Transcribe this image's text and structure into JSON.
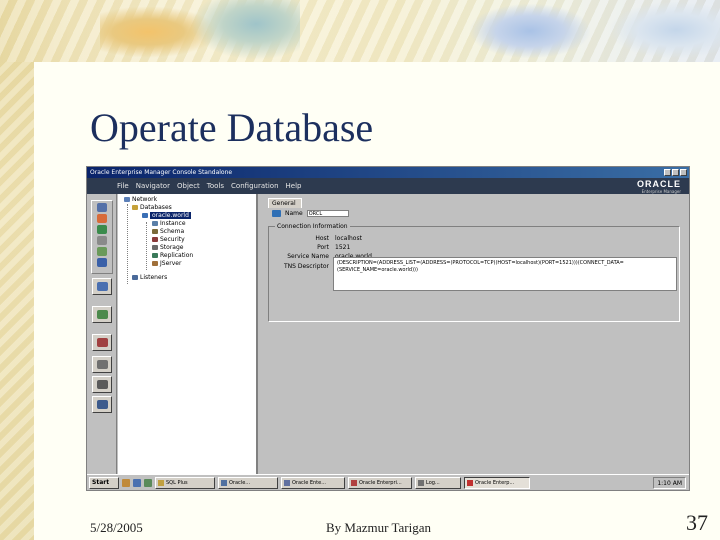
{
  "slide": {
    "title": "Operate Database",
    "footer_date": "5/28/2005",
    "footer_author": "By Mazmur Tarigan",
    "page_number": "37"
  },
  "window": {
    "title": "Oracle Enterprise Manager Console Standalone",
    "menu": [
      "File",
      "Navigator",
      "Object",
      "Tools",
      "Configuration",
      "Help"
    ],
    "brand": "ORACLE",
    "brand_sub": "Enterprise Manager"
  },
  "tree": {
    "root": "Network",
    "databases": "Databases",
    "selected": "oracle.world",
    "children": [
      "Instance",
      "Schema",
      "Security",
      "Storage",
      "Replication",
      "JServer"
    ],
    "listeners": "Listeners"
  },
  "detail": {
    "tab": "General",
    "name_label": "Name",
    "name_value": "ORCL",
    "connection_title": "Connection Information",
    "fields": [
      {
        "label": "Host",
        "value": "localhost"
      },
      {
        "label": "Port",
        "value": "1521"
      },
      {
        "label": "Service Name",
        "value": "oracle.world"
      }
    ],
    "tns_label": "TNS Descriptor",
    "tns_value": "(DESCRIPTION=(ADDRESS_LIST=(ADDRESS=(PROTOCOL=TCP)(HOST=localhost)(PORT=1521)))(CONNECT_DATA=(SERVICE_NAME=oracle.world)))"
  },
  "taskbar": {
    "start": "Start",
    "tasks": [
      "SQL Plus",
      "Oracle...",
      "Oracle Ente...",
      "Oracle Enterpri...",
      "Log..."
    ],
    "active_task": "Oracle Enterp...",
    "clock": "1:10 AM"
  },
  "colors": {
    "title_color": "#1c2f5e",
    "menubar_bg": "#2d3a4f",
    "selection": "#0a246a",
    "window_bg": "#c0c0c0"
  }
}
